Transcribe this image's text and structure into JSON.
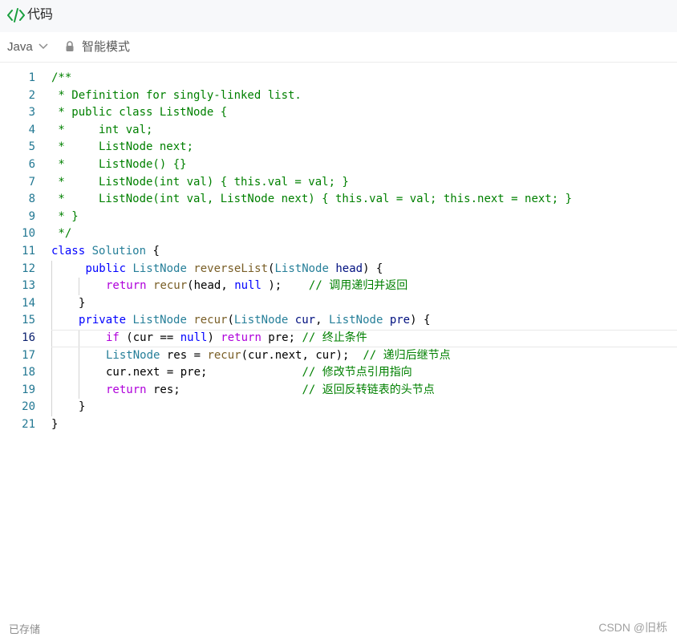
{
  "header": {
    "title": "代码"
  },
  "toolbar": {
    "language": "Java",
    "mode_label": "智能模式"
  },
  "editor": {
    "active_line": 16,
    "lines": [
      [
        [
          "c-com",
          "/**"
        ]
      ],
      [
        [
          "c-com",
          " * Definition for singly-linked list."
        ]
      ],
      [
        [
          "c-com",
          " * public class ListNode {"
        ]
      ],
      [
        [
          "c-com",
          " *     int val;"
        ]
      ],
      [
        [
          "c-com",
          " *     ListNode next;"
        ]
      ],
      [
        [
          "c-com",
          " *     ListNode() {}"
        ]
      ],
      [
        [
          "c-com",
          " *     ListNode(int val) { this.val = val; }"
        ]
      ],
      [
        [
          "c-com",
          " *     ListNode(int val, ListNode next) { this.val = val; this.next = next; }"
        ]
      ],
      [
        [
          "c-com",
          " * }"
        ]
      ],
      [
        [
          "c-com",
          " */"
        ]
      ],
      [
        [
          "c-kw",
          "class"
        ],
        [
          "",
          "",
          " "
        ],
        [
          "c-type",
          "Solution"
        ],
        [
          "",
          " {"
        ]
      ],
      [
        [
          "",
          " "
        ],
        [
          "c-kw",
          "public"
        ],
        [
          "",
          " "
        ],
        [
          "c-type",
          "ListNode"
        ],
        [
          "",
          " "
        ],
        [
          "c-fn",
          "reverseList"
        ],
        [
          "",
          "("
        ],
        [
          "c-type",
          "ListNode"
        ],
        [
          "",
          " "
        ],
        [
          "c-var",
          "head"
        ],
        [
          "",
          ") {"
        ]
      ],
      [
        [
          "c-ctrl",
          "return"
        ],
        [
          "",
          " "
        ],
        [
          "c-fn",
          "recur"
        ],
        [
          "",
          "(head, "
        ],
        [
          "c-kw",
          "null"
        ],
        [
          "",
          " );    "
        ],
        [
          "c-com",
          "// 调用递归并返回"
        ]
      ],
      [
        [
          "",
          "}"
        ]
      ],
      [
        [
          "c-kw",
          "private"
        ],
        [
          "",
          " "
        ],
        [
          "c-type",
          "ListNode"
        ],
        [
          "",
          " "
        ],
        [
          "c-fn",
          "recur"
        ],
        [
          "",
          "("
        ],
        [
          "c-type",
          "ListNode"
        ],
        [
          "",
          " "
        ],
        [
          "c-var",
          "cur"
        ],
        [
          "",
          ", "
        ],
        [
          "c-type",
          "ListNode"
        ],
        [
          "",
          " "
        ],
        [
          "c-var",
          "pre"
        ],
        [
          "",
          ") {"
        ]
      ],
      [
        [
          "c-ctrl",
          "if"
        ],
        [
          "",
          " (cur == "
        ],
        [
          "c-kw",
          "null"
        ],
        [
          "",
          ") "
        ],
        [
          "c-ctrl",
          "return"
        ],
        [
          "",
          " pre; "
        ],
        [
          "c-com",
          "// 终止条件"
        ]
      ],
      [
        [
          "c-type",
          "ListNode"
        ],
        [
          "",
          " res = "
        ],
        [
          "c-fn",
          "recur"
        ],
        [
          "",
          "(cur.next, cur);  "
        ],
        [
          "c-com",
          "// 递归后继节点"
        ]
      ],
      [
        [
          "",
          "cur.next = pre;              "
        ],
        [
          "c-com",
          "// 修改节点引用指向"
        ]
      ],
      [
        [
          "c-ctrl",
          "return"
        ],
        [
          "",
          " res;                  "
        ],
        [
          "c-com",
          "// 返回反转链表的头节点"
        ]
      ],
      [
        [
          "",
          "}"
        ]
      ],
      [
        [
          "",
          "}"
        ]
      ]
    ],
    "indents": [
      0,
      0,
      0,
      0,
      0,
      0,
      0,
      0,
      0,
      0,
      0,
      1,
      2,
      1,
      1,
      2,
      2,
      2,
      2,
      1,
      0
    ]
  },
  "footer": {
    "status": "已存储",
    "watermark": "CSDN @旧栎"
  }
}
